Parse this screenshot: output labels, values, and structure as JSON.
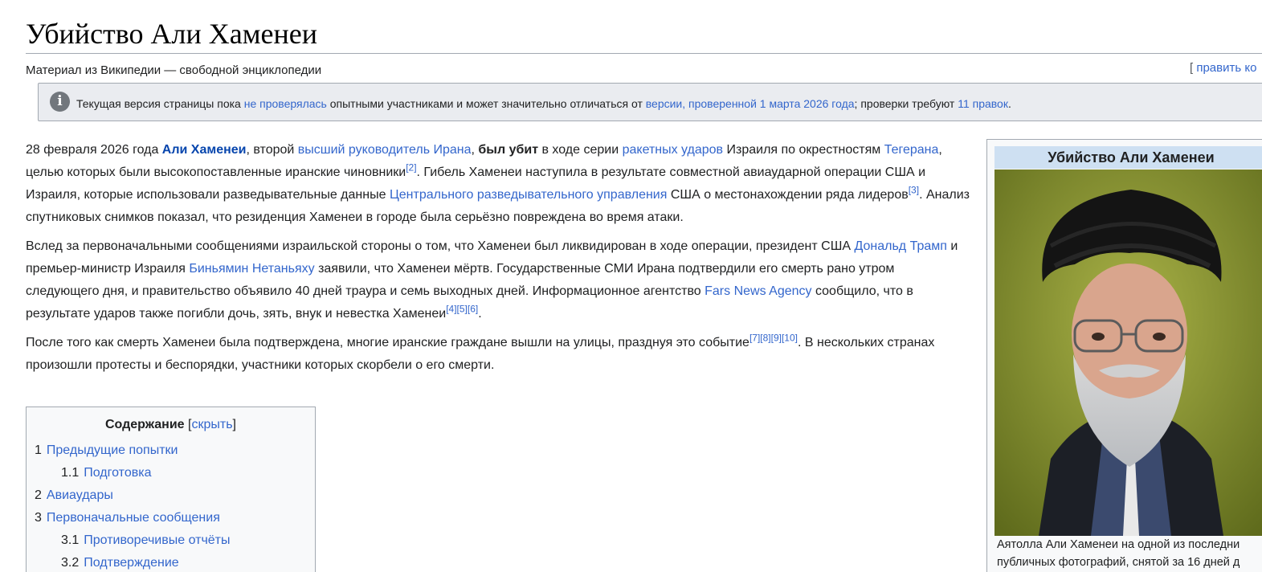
{
  "page": {
    "title": "Убийство Али Хаменеи",
    "tagline": "Материал из Википедии — свободной энциклопедии",
    "edit_link": "править ко"
  },
  "notice": {
    "icon": "info-icon",
    "t1": "Текущая версия страницы пока ",
    "l1": "не проверялась",
    "t2": " опытными участниками и может значительно отличаться от ",
    "l2": "версии, проверенной 1 марта 2026 года",
    "t3": "; проверки требуют ",
    "l3": "11 правок",
    "t4": "."
  },
  "para1": {
    "s1": "28 февраля 2026 года ",
    "l_khamenei": "Али Хаменеи",
    "s2": ", второй ",
    "l_leader": "высший руководитель Ирана",
    "s3": ", ",
    "b_killed": "был убит",
    "s4": " в ходе серии ",
    "l_strikes": "ракетных ударов",
    "s5": " Израиля по окрестностям ",
    "l_tehran": "Тегерана",
    "s6": ", целью которых были высокопоставленные иранские чиновники",
    "r2": "[2]",
    "s7": ". Гибель Хаменеи наступила в результате совместной авиаударной операции США и Израиля, которые использовали разведывательные данные ",
    "l_cia": "Центрального разведывательного управления",
    "s8": " США о местонахождении ряда лидеров",
    "r3": "[3]",
    "s9": ". Анализ спутниковых снимков показал, что резиденция Хаменеи в городе была серьёзно повреждена во время атаки."
  },
  "para2": {
    "s1": "Вслед за первоначальными сообщениями израильской стороны о том, что Хаменеи был ликвидирован в ходе операции, президент США ",
    "l_trump": "Дональд Трамп",
    "s2": " и премьер-министр Израиля ",
    "l_netanyahu": "Биньямин Нетаньяху",
    "s3": " заявили, что Хаменеи мёртв. Государственные СМИ Ирана подтвердили его смерть рано утром следующего дня, и правительство объявило 40 дней траура и семь выходных дней. Информационное агентство ",
    "l_fars": "Fars News Agency",
    "s4": " сообщило, что в результате ударов также погибли дочь, зять, внук и невестка Хаменеи",
    "r4": "[4]",
    "r5": "[5]",
    "r6": "[6]",
    "s5": "."
  },
  "para3": {
    "s1": "После того как смерть Хаменеи была подтверждена, многие иранские граждане вышли на улицы, празднуя это событие",
    "r7": "[7]",
    "r8": "[8]",
    "r9": "[9]",
    "r10": "[10]",
    "s2": ". В нескольких странах произошли протесты и беспорядки, участники которых скорбели о его смерти."
  },
  "toc": {
    "title": "Содержание",
    "bracket_open": " [",
    "hide": "скрыть",
    "bracket_close": "]",
    "items": [
      {
        "num": "1",
        "label": "Предыдущие попытки"
      },
      {
        "num": "1.1",
        "label": "Подготовка"
      },
      {
        "num": "2",
        "label": "Авиаудары"
      },
      {
        "num": "3",
        "label": "Первоначальные сообщения"
      },
      {
        "num": "3.1",
        "label": "Противоречивые отчёты"
      },
      {
        "num": "3.2",
        "label": "Подтверждение"
      }
    ]
  },
  "infobox": {
    "title": "Убийство Али Хаменеи",
    "caption_line1": "Аятолла Али Хаменеи на одной из последни",
    "caption_line2": "публичных фотографий, снятой за 16 дней д"
  }
}
